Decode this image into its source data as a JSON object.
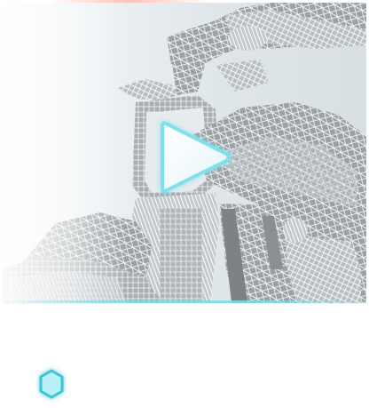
{
  "video": {
    "thumbnail": "wireframe-motorcycle",
    "play_icon": "play-icon"
  },
  "footer": {
    "nav_icon": "hexagon-icon"
  },
  "colors": {
    "accent": "#7fe0ea",
    "accent_deep": "#3fc4d4",
    "top_accent": "#ff8c78",
    "wire": "#c9cfd2",
    "wire_dark": "#8c9296"
  }
}
